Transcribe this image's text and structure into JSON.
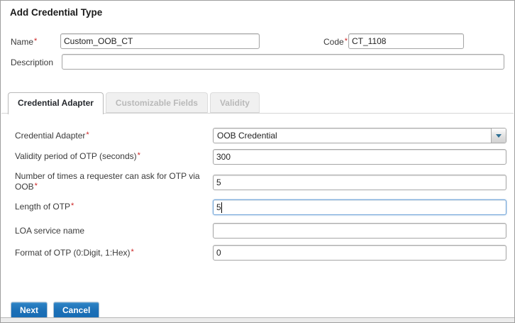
{
  "window": {
    "title": "Add Credential Type"
  },
  "misc": {
    "required_marker": "*"
  },
  "header_fields": {
    "name": {
      "label": "Name",
      "value": "Custom_OOB_CT"
    },
    "code": {
      "label": "Code",
      "value": "CT_1108"
    },
    "description": {
      "label": "Description",
      "value": ""
    }
  },
  "tabs": {
    "items": [
      {
        "label": "Credential Adapter",
        "state": "active"
      },
      {
        "label": "Customizable Fields",
        "state": "disabled"
      },
      {
        "label": "Validity",
        "state": "disabled"
      }
    ]
  },
  "form": {
    "rows": [
      {
        "label": "Credential Adapter",
        "required": true,
        "control": "combobox",
        "value": "OOB Credential"
      },
      {
        "label": "Validity period of OTP (seconds)",
        "required": true,
        "control": "textbox",
        "value": "300"
      },
      {
        "label": "Number of times a requester can ask for OTP via OOB",
        "required": true,
        "control": "textbox",
        "value": "5"
      },
      {
        "label": "Length of OTP",
        "required": true,
        "control": "textbox",
        "value": "5",
        "focused": true
      },
      {
        "label": "LOA service name",
        "required": false,
        "control": "textbox",
        "value": ""
      },
      {
        "label": "Format of OTP (0:Digit, 1:Hex)",
        "required": true,
        "control": "textbox",
        "value": "0"
      }
    ]
  },
  "footer": {
    "next_label": "Next",
    "cancel_label": "Cancel"
  },
  "colors": {
    "accent_blue": "#1b72bd",
    "required_red": "#cc2222",
    "focus_border": "#6da3d8",
    "dropdown_arrow": "#2c6e93"
  }
}
